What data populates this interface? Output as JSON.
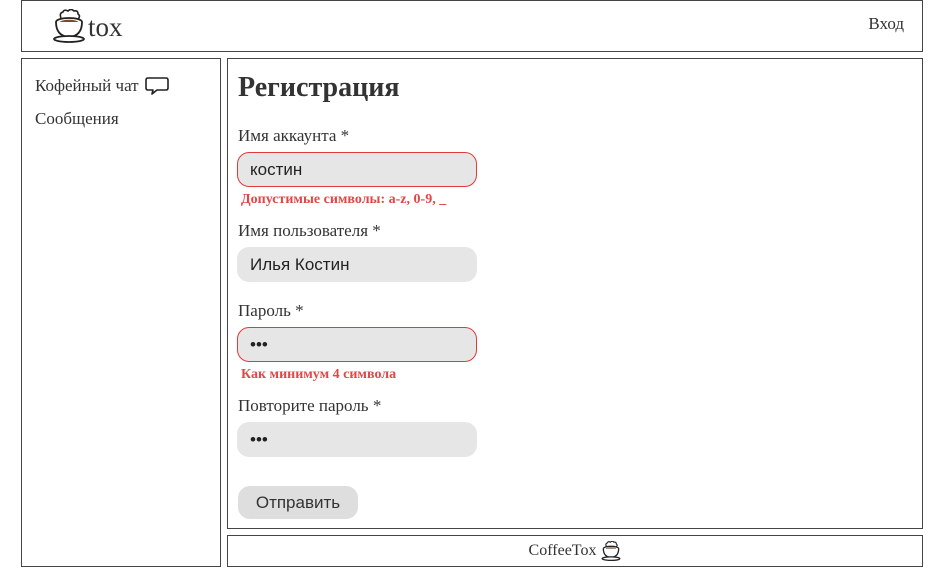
{
  "header": {
    "logo_text": "tox",
    "logo_icon": "coffee-cup-icon",
    "login_label": "Вход"
  },
  "sidebar": {
    "items": [
      {
        "label": "Кофейный чат",
        "icon": "chat-bubble-icon"
      },
      {
        "label": "Сообщения"
      }
    ]
  },
  "form": {
    "title": "Регистрация",
    "account": {
      "label": "Имя аккаунта *",
      "value": "костин",
      "error": "Допустимые символы: a-z, 0-9, _"
    },
    "username": {
      "label": "Имя пользователя *",
      "value": "Илья Костин"
    },
    "password": {
      "label": "Пароль *",
      "value": "123",
      "error": "Как минимум 4 символа"
    },
    "password_repeat": {
      "label": "Повторите пароль *",
      "value": "123"
    },
    "submit_label": "Отправить"
  },
  "footer": {
    "text": "CoffeeTox",
    "icon": "coffee-cup-icon"
  },
  "colors": {
    "error": "#e04848",
    "input_bg": "#e6e6e6",
    "border": "#444444"
  }
}
